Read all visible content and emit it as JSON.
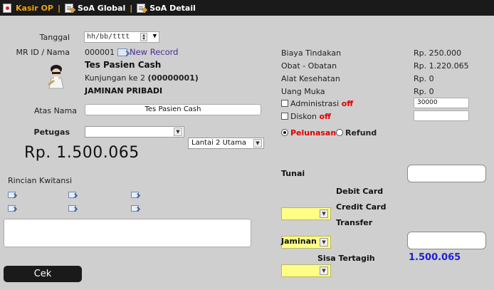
{
  "tabs": [
    {
      "label": "Kasir OP"
    },
    {
      "label": "SoA Global"
    },
    {
      "label": "SoA Detail"
    }
  ],
  "form": {
    "tanggal_label": "Tanggal",
    "tanggal_placeholder": "hh/bb/tttt",
    "mr_label": "MR ID / Nama",
    "mr_id": "000001",
    "new_record": "New Record",
    "patient_name": "Tes Pasien Cash",
    "kunjungan_prefix": "Kunjungan ke 2",
    "kunjungan_code": "(00000001)",
    "jaminan_type": "JAMINAN PRIBADI",
    "atas_nama_label": "Atas Nama",
    "atas_nama_value": "Tes Pasien Cash",
    "petugas_label": "Petugas",
    "petugas_value": "",
    "lantai_value": "Lantai 2 Utama",
    "total": "Rp. 1.500.065",
    "rincian_label": "Rincian Kwitansi",
    "cek_label": "Cek"
  },
  "billing": {
    "rows": [
      {
        "label": "Biaya Tindakan",
        "value": "Rp. 250.000"
      },
      {
        "label": "Obat - Obatan",
        "value": "Rp. 1.220.065"
      },
      {
        "label": "Alat Kesehatan",
        "value": "Rp. 0"
      },
      {
        "label": "Uang Muka",
        "value": "Rp. 0"
      }
    ],
    "administrasi_label": "Administrasi",
    "administrasi_state": "off",
    "administrasi_value": "30000",
    "diskon_label": "Diskon",
    "diskon_state": "off",
    "pelunasan_label": "Pelunasan",
    "refund_label": "Refund"
  },
  "payment": {
    "tunai_label": "Tunai",
    "debit_label": "Debit Card",
    "credit_label": "Credit Card",
    "transfer_label": "Transfer",
    "jaminan_label": "Jaminan",
    "sisa_label": "Sisa Tertagih",
    "sisa_value": "1.500.065"
  },
  "colors": {
    "accent": "#f0a30a",
    "background": "#cfcfcf",
    "sisa": "#1f1fd6",
    "off": "#e00000",
    "highlight": "#ffff88"
  }
}
